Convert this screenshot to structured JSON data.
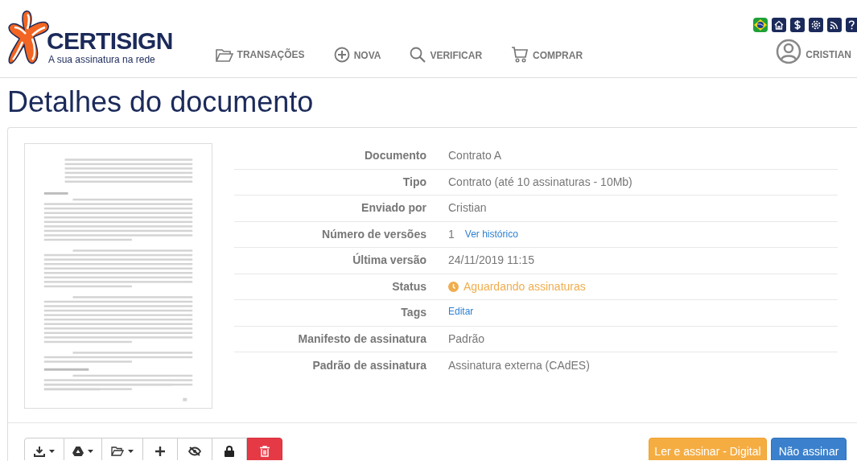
{
  "header": {
    "logo": {
      "name": "CERTISIGN",
      "tagline": "A sua assinatura na rede"
    },
    "nav": [
      {
        "label": "TRANSAÇÕES"
      },
      {
        "label": "NOVA"
      },
      {
        "label": "VERIFICAR"
      },
      {
        "label": "COMPRAR"
      }
    ],
    "user": {
      "name": "CRISTIAN"
    }
  },
  "page_title": "Detalhes do documento",
  "details": [
    {
      "label": "Documento",
      "kind": "text",
      "value": "Contrato A"
    },
    {
      "label": "Tipo",
      "kind": "text",
      "value": "Contrato (até 10 assinaturas - 10Mb)"
    },
    {
      "label": "Enviado por",
      "kind": "text",
      "value": "Cristian"
    },
    {
      "label": "Número de versões",
      "kind": "text_link",
      "value": "1",
      "link": "Ver histórico"
    },
    {
      "label": "Última versão",
      "kind": "text",
      "value": "24/11/2019 11:15"
    },
    {
      "label": "Status",
      "kind": "status",
      "value": "Aguardando assinaturas",
      "color": "#f0ad4e"
    },
    {
      "label": "Tags",
      "kind": "link",
      "link": "Editar"
    },
    {
      "label": "Manifesto de assinatura",
      "kind": "text",
      "value": "Padrão"
    },
    {
      "label": "Padrão de assinatura",
      "kind": "text",
      "value": "Assinatura externa (CAdES)"
    }
  ],
  "actions": [
    {
      "label": "Ler e assinar - Digital",
      "kind": "warning"
    },
    {
      "label": "Não assinar",
      "kind": "primary"
    }
  ]
}
